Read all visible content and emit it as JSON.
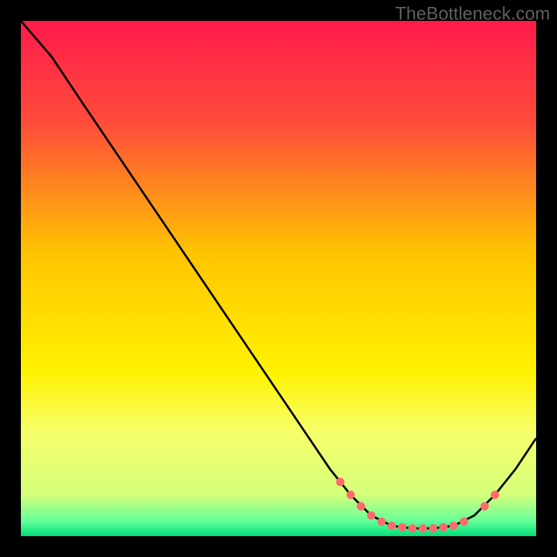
{
  "watermark": "TheBottleneck.com",
  "chart_data": {
    "type": "line",
    "title": "",
    "xlabel": "",
    "ylabel": "",
    "xlim": [
      0,
      100
    ],
    "ylim": [
      0,
      100
    ],
    "background_gradient": {
      "stops": [
        {
          "offset": 0,
          "color": "#ff1a4b"
        },
        {
          "offset": 20,
          "color": "#ff4d3a"
        },
        {
          "offset": 45,
          "color": "#ffc400"
        },
        {
          "offset": 68,
          "color": "#fff200"
        },
        {
          "offset": 80,
          "color": "#f5ff6b"
        },
        {
          "offset": 92,
          "color": "#d4ff7a"
        },
        {
          "offset": 97,
          "color": "#66ff99"
        },
        {
          "offset": 100,
          "color": "#00e07a"
        }
      ]
    },
    "series": [
      {
        "name": "bottleneck-curve",
        "color": "#000000",
        "points": [
          {
            "x": 0,
            "y": 100
          },
          {
            "x": 6,
            "y": 93
          },
          {
            "x": 12,
            "y": 84
          },
          {
            "x": 60,
            "y": 13
          },
          {
            "x": 64,
            "y": 8
          },
          {
            "x": 68,
            "y": 4
          },
          {
            "x": 72,
            "y": 2
          },
          {
            "x": 76,
            "y": 1.5
          },
          {
            "x": 80,
            "y": 1.5
          },
          {
            "x": 84,
            "y": 2
          },
          {
            "x": 88,
            "y": 4
          },
          {
            "x": 92,
            "y": 8
          },
          {
            "x": 96,
            "y": 13
          },
          {
            "x": 100,
            "y": 19
          }
        ]
      }
    ],
    "markers": {
      "name": "highlight-dots",
      "color": "#ff6b6b",
      "radius": 6,
      "points": [
        {
          "x": 62,
          "y": 10.5
        },
        {
          "x": 64,
          "y": 8
        },
        {
          "x": 66,
          "y": 5.8
        },
        {
          "x": 68,
          "y": 4
        },
        {
          "x": 70,
          "y": 2.8
        },
        {
          "x": 72,
          "y": 2
        },
        {
          "x": 74,
          "y": 1.7
        },
        {
          "x": 76,
          "y": 1.5
        },
        {
          "x": 78,
          "y": 1.5
        },
        {
          "x": 80,
          "y": 1.5
        },
        {
          "x": 82,
          "y": 1.7
        },
        {
          "x": 84,
          "y": 2
        },
        {
          "x": 86,
          "y": 2.8
        },
        {
          "x": 90,
          "y": 5.8
        },
        {
          "x": 92,
          "y": 8
        }
      ]
    }
  }
}
